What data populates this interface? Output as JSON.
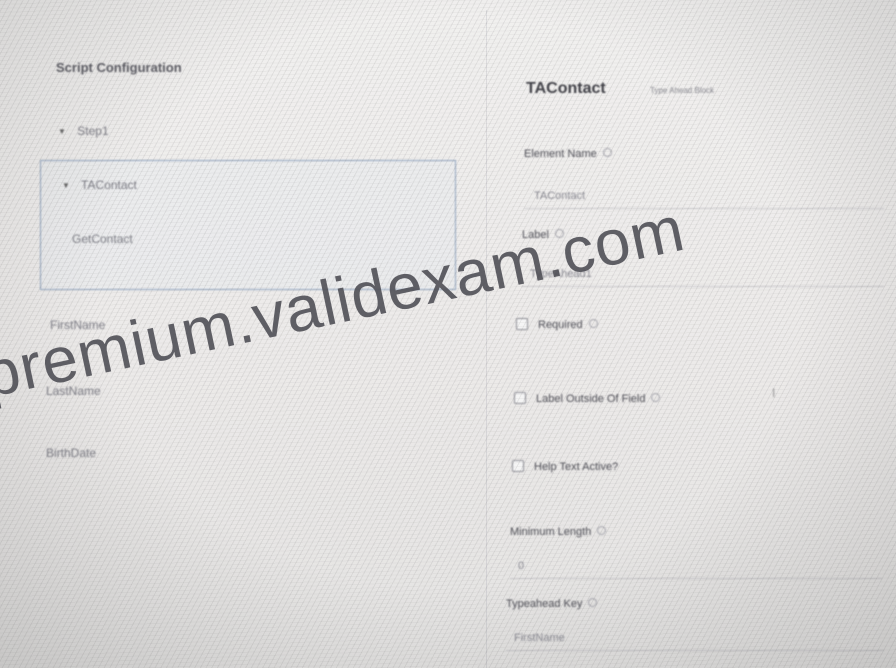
{
  "left_panel": {
    "title": "Script Configuration",
    "items": [
      {
        "label": "Step1",
        "expanded": true
      },
      {
        "label": "TAContact",
        "expanded": true,
        "selected": true
      },
      {
        "label": "GetContact"
      },
      {
        "label": "FirstName"
      },
      {
        "label": "LastName"
      },
      {
        "label": "BirthDate"
      }
    ]
  },
  "right_panel": {
    "element_title": "TAContact",
    "element_type": "Type Ahead Block",
    "fields": {
      "element_name": {
        "label": "Element Name",
        "value": "TAContact"
      },
      "label": {
        "label": "Label",
        "value": "TypeAhead1"
      },
      "required": {
        "label": "Required",
        "checked": false
      },
      "label_outside": {
        "label": "Label Outside Of Field",
        "checked": false
      },
      "help_text": {
        "label": "Help Text Active?",
        "checked": false
      },
      "minimum_length": {
        "label": "Minimum Length",
        "value": "0"
      },
      "typeahead_key": {
        "label": "Typeahead Key",
        "value": "FirstName"
      }
    },
    "cursor_glyph": "I"
  },
  "watermark": {
    "text": "premium.validexam.com"
  },
  "icons": {
    "chevron": "▼"
  }
}
